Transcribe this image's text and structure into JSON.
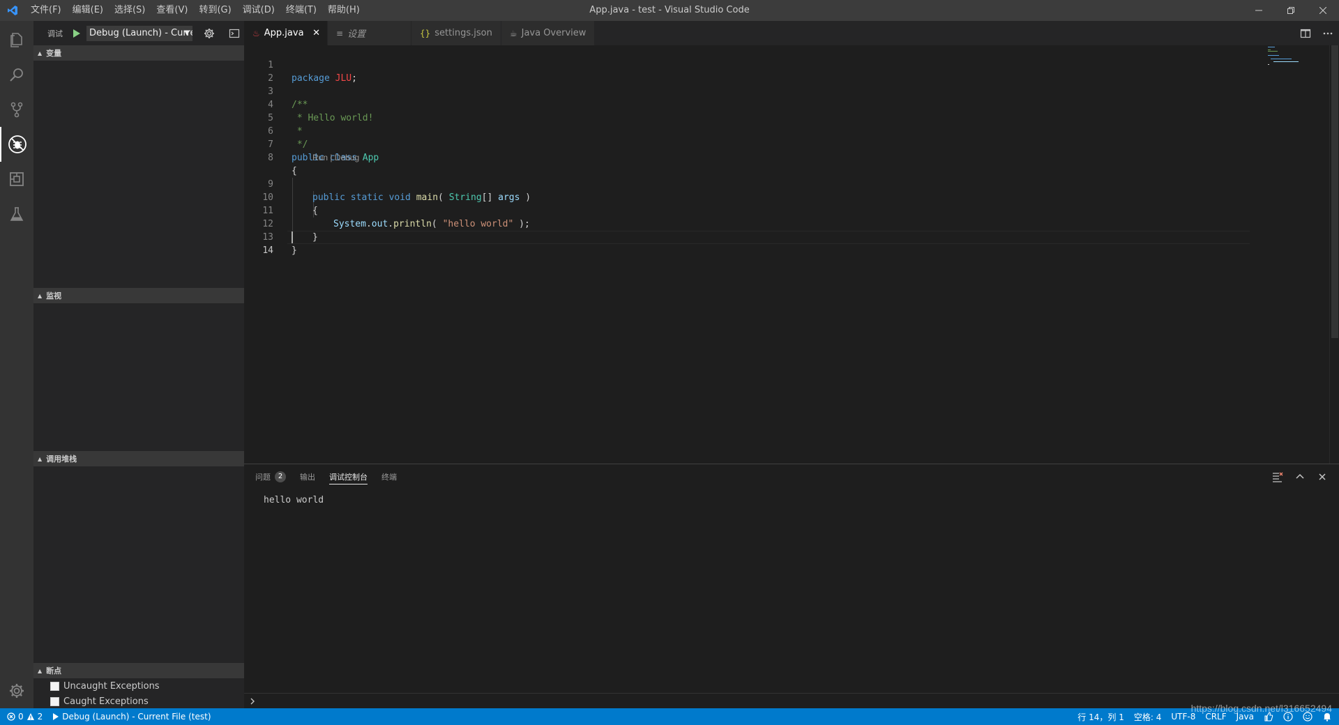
{
  "titlebar": {
    "title": "App.java - test - Visual Studio Code",
    "menu": [
      "文件(F)",
      "编辑(E)",
      "选择(S)",
      "查看(V)",
      "转到(G)",
      "调试(D)",
      "终端(T)",
      "帮助(H)"
    ]
  },
  "debug": {
    "title": "调试",
    "config": "Debug (Launch) - Current File (test)"
  },
  "sidebar": {
    "sections": {
      "variables": "变量",
      "watch": "监视",
      "callstack": "调用堆栈",
      "breakpoints": "断点"
    },
    "breakpoints": [
      "Uncaught Exceptions",
      "Caught Exceptions"
    ]
  },
  "tabs": [
    {
      "label": "App.java",
      "active": true
    },
    {
      "label": "设置",
      "active": false
    },
    {
      "label": "settings.json",
      "active": false
    },
    {
      "label": "Java Overview",
      "active": false
    }
  ],
  "editor": {
    "line_numbers": [
      "1",
      "2",
      "3",
      "4",
      "5",
      "6",
      "7",
      "8",
      "9",
      "10",
      "11",
      "12",
      "13",
      "14"
    ],
    "codelens": "Run | Debug",
    "code": {
      "l1_kw": "package",
      "l1_pkg": "JLU",
      "l1_semi": ";",
      "l3": "/**",
      "l4": " * Hello world!",
      "l5": " *",
      "l6": " */",
      "l7_kw": "public class",
      "l7_name": "App",
      "l8": "{",
      "l9_kw": "public static void",
      "l9_fn": "main",
      "l9_p1": "(",
      "l9_ty": "String",
      "l9_p2": "[]",
      "l9_vr": "args",
      "l9_p3": ")",
      "l10": "{",
      "l11_vr1": "System",
      "l11_dot1": ".",
      "l11_vr2": "out",
      "l11_dot2": ".",
      "l11_fn": "println",
      "l11_p1": "(",
      "l11_st": "\"hello world\"",
      "l11_p2": ");",
      "l12": "}",
      "l13": "}"
    }
  },
  "panel": {
    "tabs": [
      "问题",
      "输出",
      "调试控制台",
      "终端"
    ],
    "problems_count": "2",
    "output": "hello world"
  },
  "statusbar": {
    "errors": "0",
    "warnings": "2",
    "debug_config": "Debug (Launch) - Current File (test)",
    "position": "行 14，列 1",
    "spaces": "空格: 4",
    "encoding": "UTF-8",
    "eol": "CRLF",
    "language": "Java"
  },
  "watermark": "https://blog.csdn.net/l316652494",
  "colors": {
    "accent": "#007acc",
    "keyword": "#569cd6",
    "type": "#4ec9b0",
    "comment": "#6a9955",
    "string": "#ce9178",
    "function": "#dcdcaa"
  }
}
